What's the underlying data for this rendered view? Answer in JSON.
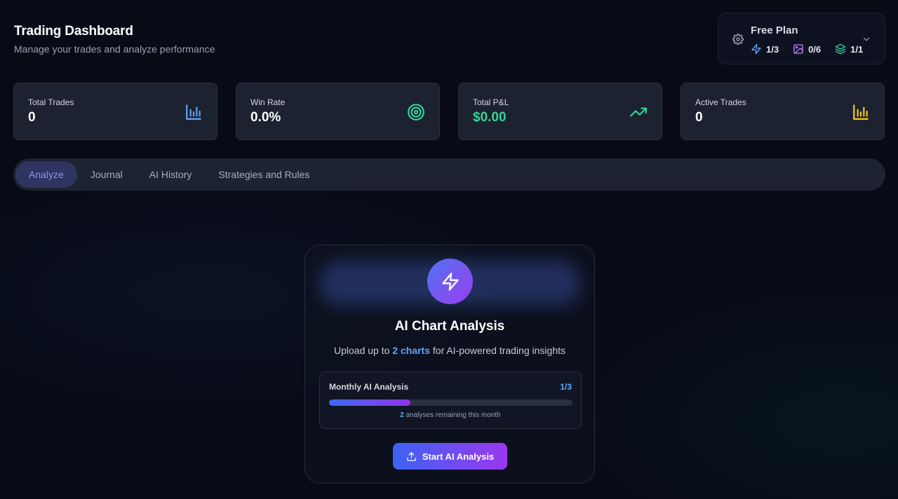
{
  "header": {
    "title": "Trading Dashboard",
    "subtitle": "Manage your trades and analyze performance"
  },
  "plan": {
    "name": "Free Plan",
    "stats": [
      {
        "icon": "bolt-icon",
        "value": "1/3",
        "color": "#60a5fa"
      },
      {
        "icon": "image-icon",
        "value": "0/6",
        "color": "#c084fc"
      },
      {
        "icon": "layers-icon",
        "value": "1/1",
        "color": "#34d399"
      }
    ]
  },
  "cards": [
    {
      "label": "Total Trades",
      "value": "0",
      "icon": "bar-chart-icon",
      "icon_color": "#60a5fa"
    },
    {
      "label": "Win Rate",
      "value": "0.0%",
      "icon": "target-icon",
      "icon_color": "#34d399"
    },
    {
      "label": "Total P&L",
      "value": "$0.00",
      "icon": "trending-up-icon",
      "icon_color": "#34d399",
      "value_color": "#34d399"
    },
    {
      "label": "Active Trades",
      "value": "0",
      "icon": "bar-chart-icon",
      "icon_color": "#facc15"
    }
  ],
  "tabs": [
    {
      "label": "Analyze",
      "active": true
    },
    {
      "label": "Journal",
      "active": false
    },
    {
      "label": "AI History",
      "active": false
    },
    {
      "label": "Strategies and Rules",
      "active": false
    }
  ],
  "analysis": {
    "title": "AI Chart Analysis",
    "subtitle_pre": "Upload up to ",
    "subtitle_highlight": "2 charts",
    "subtitle_post": " for AI-powered trading insights",
    "usage": {
      "label": "Monthly AI Analysis",
      "count": "1/3",
      "progress_fraction": 0.333,
      "remaining_num": "2",
      "remaining_text": " analyses remaining this month"
    },
    "button_label": "Start AI Analysis"
  },
  "colors": {
    "accent_blue": "#60a5fa",
    "accent_purple": "#9333ea",
    "positive_green": "#34d399",
    "warning_yellow": "#facc15",
    "background": "#080b16"
  }
}
